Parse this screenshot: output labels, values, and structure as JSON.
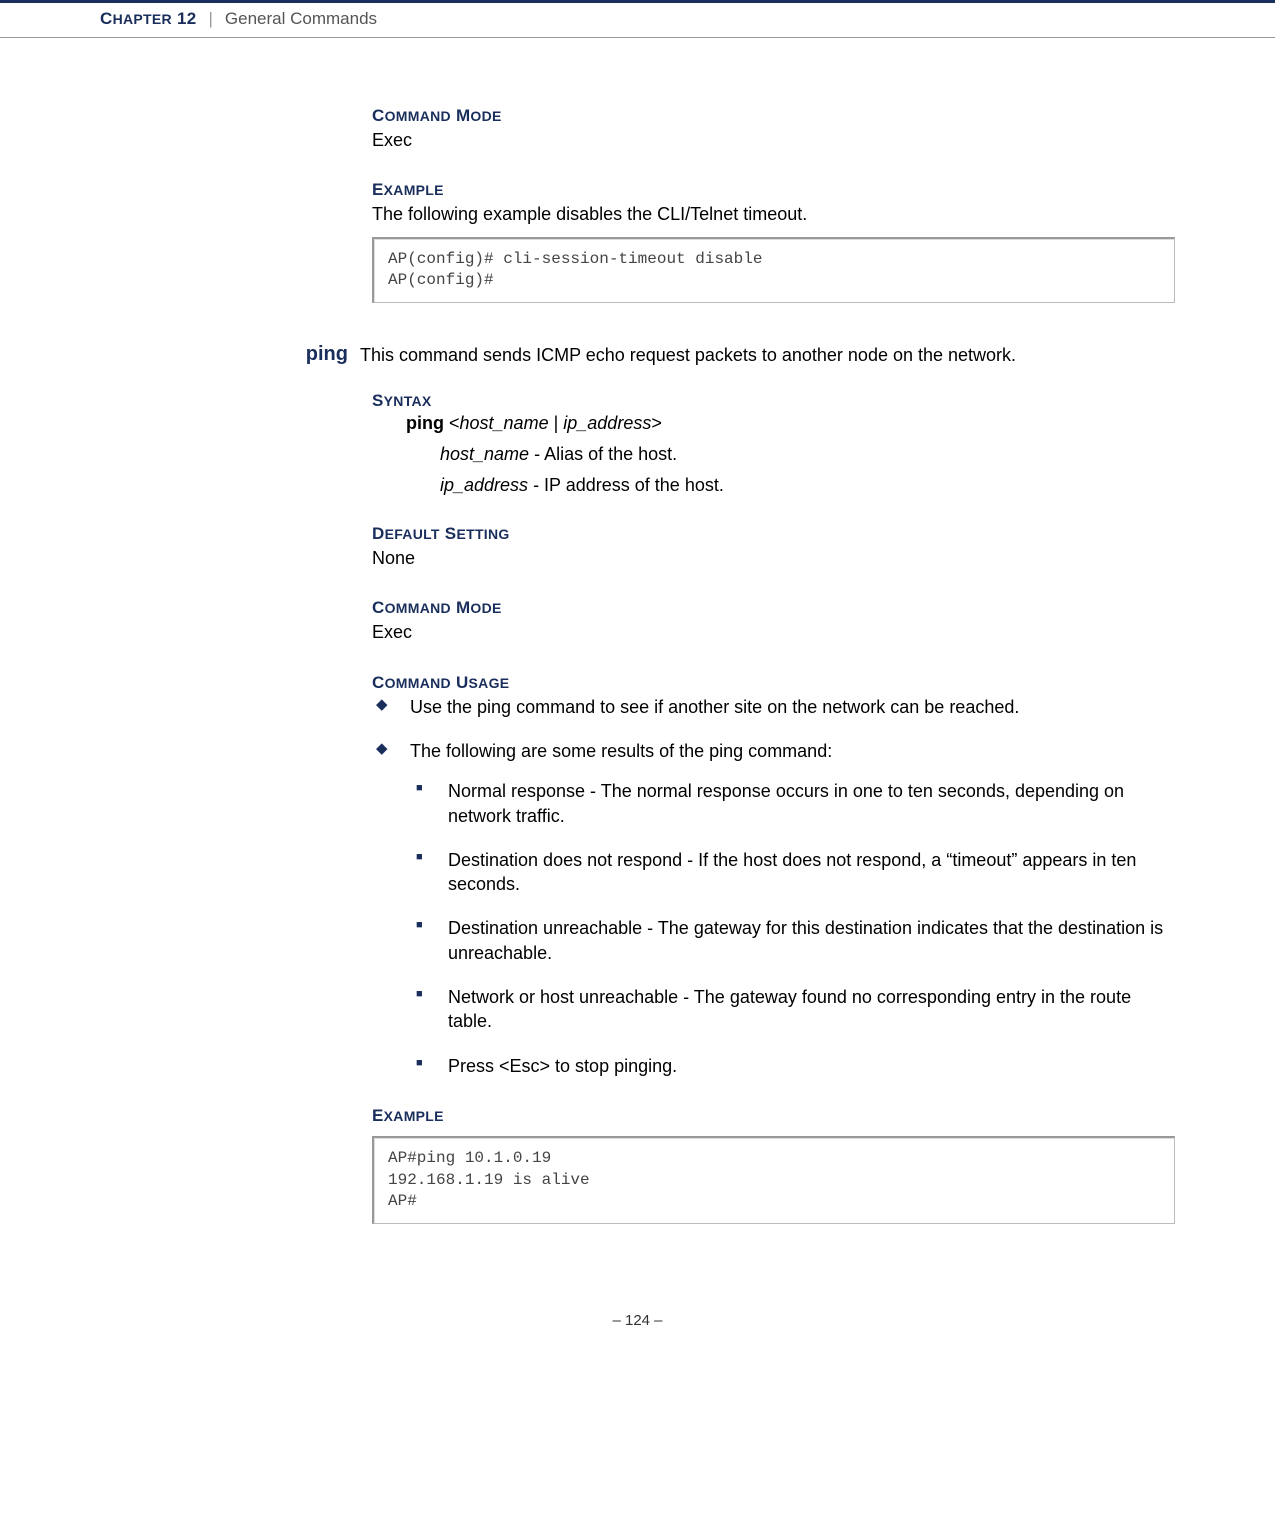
{
  "header": {
    "chapter_caps": "C",
    "chapter_rest": "HAPTER",
    "chapter_num": " 12",
    "section": "General Commands"
  },
  "top": {
    "command_mode_head_1": "C",
    "command_mode_head_2": "OMMAND",
    "command_mode_head_3": " M",
    "command_mode_head_4": "ODE",
    "command_mode_value": "Exec",
    "example_head_1": "E",
    "example_head_2": "XAMPLE",
    "example_text": "The following example disables the CLI/Telnet timeout.",
    "example_code": "AP(config)# cli-session-timeout disable\nAP(config)#"
  },
  "ping": {
    "name": "ping",
    "desc": "This command sends ICMP echo request packets to another node on the network.",
    "syntax_head_1": "S",
    "syntax_head_2": "YNTAX",
    "syntax_cmd_bold": "ping ",
    "syntax_cmd_rest_open": "<",
    "syntax_cmd_it1": "host_name",
    "syntax_cmd_sep": " | ",
    "syntax_cmd_it2": "ip_address",
    "syntax_cmd_close": ">",
    "syntax_p1_it": "host_name",
    "syntax_p1_txt": " - Alias of the host.",
    "syntax_p2_it": "ip_address",
    "syntax_p2_txt": " - IP address of the host.",
    "default_head_1": "D",
    "default_head_2": "EFAULT",
    "default_head_3": " S",
    "default_head_4": "ETTING",
    "default_value": "None",
    "cmdmode_head_1": "C",
    "cmdmode_head_2": "OMMAND",
    "cmdmode_head_3": " M",
    "cmdmode_head_4": "ODE",
    "cmdmode_value": "Exec",
    "usage_head_1": "C",
    "usage_head_2": "OMMAND",
    "usage_head_3": " U",
    "usage_head_4": "SAGE",
    "usage_b1": "Use the ping command to see if another site on the network can be reached.",
    "usage_b2": "The following are some results of the ping command:",
    "usage_s1": "Normal response - The normal response occurs in one to ten seconds, depending on network traffic.",
    "usage_s2": "Destination does not respond - If the host does not respond, a “timeout” appears in ten seconds.",
    "usage_s3": "Destination unreachable - The gateway for this destination indicates that the destination is unreachable.",
    "usage_s4": "Network or host unreachable - The gateway found no corresponding entry in the route table.",
    "usage_s5": "Press <Esc> to stop pinging.",
    "example2_head_1": "E",
    "example2_head_2": "XAMPLE",
    "example2_code": "AP#ping 10.1.0.19\n192.168.1.19 is alive\nAP#"
  },
  "footer": {
    "page": "–  124  –"
  }
}
